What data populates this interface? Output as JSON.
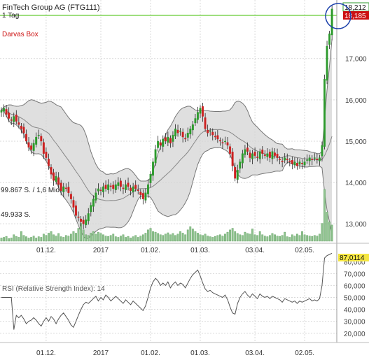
{
  "header": {
    "title": "FinTech Group AG (FTG111)",
    "interval": "1 Tag"
  },
  "overlay_label": "Darvas Box",
  "price_badges": {
    "high": "18,212",
    "low": "18,185"
  },
  "volume_labels": {
    "upper": "99.867 S. / 1,6 Mio.",
    "lower": "49.933 S."
  },
  "rsi": {
    "label": "RSI (Relative Strength Index): 14",
    "badge": "87,0114"
  },
  "colors": {
    "up": "#2c9a2c",
    "down": "#cc2020",
    "band": "#d4d4d4",
    "darvas": "#66cc33",
    "grid": "#d9d9d9",
    "volume": "#8fc38f",
    "badge_low": "#cc1111"
  },
  "chart_data": {
    "type": "candlestick",
    "price_ticks": [
      "13,000",
      "14,000",
      "15,000",
      "16,000",
      "17,000"
    ],
    "price_tick_values": [
      13,
      14,
      15,
      16,
      17
    ],
    "price_range": [
      12.58,
      18.4
    ],
    "rsi_ticks": [
      "20,000",
      "30,000",
      "40,000",
      "50,000",
      "60,000",
      "70,000",
      "80,000"
    ],
    "rsi_tick_values": [
      20,
      30,
      40,
      50,
      60,
      70,
      80
    ],
    "rsi_range": [
      14,
      86
    ],
    "x_ticks": [
      "01.12.",
      "2017",
      "01.02.",
      "01.03.",
      "03.04.",
      "02.05."
    ],
    "x_tick_index": [
      18,
      40,
      60,
      80,
      102,
      122
    ],
    "close": [
      15.75,
      15.8,
      15.65,
      15.55,
      15.5,
      15.6,
      15.48,
      15.4,
      15.3,
      15.2,
      15.0,
      14.85,
      14.8,
      14.95,
      15.1,
      15.15,
      15.0,
      14.7,
      14.6,
      14.4,
      14.2,
      14.05,
      14.15,
      13.95,
      13.8,
      13.9,
      13.85,
      13.75,
      13.6,
      13.4,
      13.2,
      13.15,
      13.05,
      13.0,
      13.1,
      13.25,
      13.45,
      13.6,
      13.75,
      13.85,
      13.8,
      13.9,
      13.85,
      13.95,
      13.9,
      13.85,
      13.95,
      14.0,
      13.9,
      13.85,
      13.95,
      13.9,
      13.8,
      13.9,
      13.85,
      13.8,
      13.7,
      13.6,
      13.75,
      13.95,
      14.2,
      14.5,
      14.8,
      15.0,
      14.9,
      15.05,
      15.0,
      15.1,
      14.95,
      15.15,
      15.3,
      15.2,
      15.25,
      15.1,
      15.05,
      15.2,
      15.3,
      15.4,
      15.55,
      15.7,
      15.8,
      15.6,
      15.3,
      15.2,
      15.25,
      15.15,
      15.1,
      15.05,
      15.0,
      14.95,
      15.0,
      14.9,
      14.7,
      14.4,
      14.1,
      14.3,
      14.5,
      14.7,
      14.8,
      14.75,
      14.6,
      14.7,
      14.65,
      14.6,
      14.75,
      14.7,
      14.65,
      14.7,
      14.6,
      14.75,
      14.65,
      14.6,
      14.55,
      14.5,
      14.6,
      14.55,
      14.5,
      14.45,
      14.5,
      14.4,
      14.5,
      14.45,
      14.5,
      14.55,
      14.6,
      14.55,
      14.6,
      14.55,
      14.6,
      14.9,
      16.5,
      17.3,
      17.6,
      18.2
    ],
    "rsi": [
      50,
      50,
      50,
      50,
      50,
      23,
      35,
      33,
      35,
      32,
      28,
      30,
      31,
      33,
      31,
      28,
      26,
      30,
      33,
      30,
      34,
      32,
      28,
      32,
      35,
      37,
      34,
      31,
      27,
      25,
      30,
      35,
      40,
      44,
      46,
      45,
      47,
      49,
      51,
      47,
      50,
      48,
      52,
      50,
      47,
      49,
      51,
      49,
      47,
      45,
      48,
      46,
      44,
      47,
      45,
      43,
      41,
      39,
      43,
      50,
      58,
      63,
      66,
      64,
      60,
      62,
      60,
      63,
      58,
      61,
      63,
      60,
      62,
      61,
      58,
      62,
      66,
      69,
      71,
      73,
      68,
      62,
      57,
      55,
      56,
      54,
      53,
      52,
      51,
      50,
      52,
      48,
      42,
      37,
      36,
      45,
      50,
      53,
      55,
      52,
      50,
      53,
      51,
      49,
      53,
      51,
      50,
      51,
      49,
      51,
      50,
      49,
      48,
      46,
      49,
      48,
      47,
      46,
      47,
      45,
      47,
      46,
      47,
      48,
      49,
      47,
      48,
      47,
      49,
      60,
      83,
      85,
      86,
      87.01
    ],
    "volume": [
      0.1,
      0.12,
      0.15,
      0.08,
      0.1,
      0.2,
      0.15,
      0.12,
      0.3,
      0.18,
      0.14,
      0.1,
      0.12,
      0.16,
      0.1,
      0.14,
      0.12,
      0.22,
      0.18,
      0.25,
      0.3,
      0.2,
      0.16,
      0.24,
      0.14,
      0.12,
      0.18,
      0.16,
      0.22,
      0.3,
      0.25,
      0.4,
      0.55,
      0.35,
      0.2,
      0.18,
      0.25,
      0.3,
      0.22,
      0.28,
      0.24,
      0.2,
      0.16,
      0.15,
      0.18,
      0.22,
      0.14,
      0.12,
      0.16,
      0.2,
      0.12,
      0.15,
      0.1,
      0.14,
      0.18,
      0.12,
      0.16,
      0.2,
      0.25,
      0.35,
      0.4,
      0.3,
      0.28,
      0.24,
      0.2,
      0.18,
      0.22,
      0.26,
      0.2,
      0.24,
      0.18,
      0.22,
      0.3,
      0.25,
      0.2,
      0.35,
      0.45,
      0.38,
      0.3,
      0.25,
      0.2,
      0.18,
      0.22,
      0.16,
      0.14,
      0.12,
      0.15,
      0.18,
      0.2,
      0.16,
      0.22,
      0.28,
      0.35,
      0.4,
      0.3,
      0.24,
      0.2,
      0.18,
      0.28,
      0.24,
      0.22,
      0.38,
      0.2,
      0.18,
      0.3,
      0.2,
      0.16,
      0.14,
      0.18,
      0.24,
      0.2,
      0.16,
      0.15,
      0.18,
      0.28,
      0.14,
      0.12,
      0.2,
      0.16,
      0.22,
      0.18,
      0.3,
      0.2,
      0.18,
      0.16,
      0.15,
      0.18,
      0.16,
      0.22,
      0.55,
      1.6,
      0.9,
      0.6,
      0.5
    ]
  }
}
